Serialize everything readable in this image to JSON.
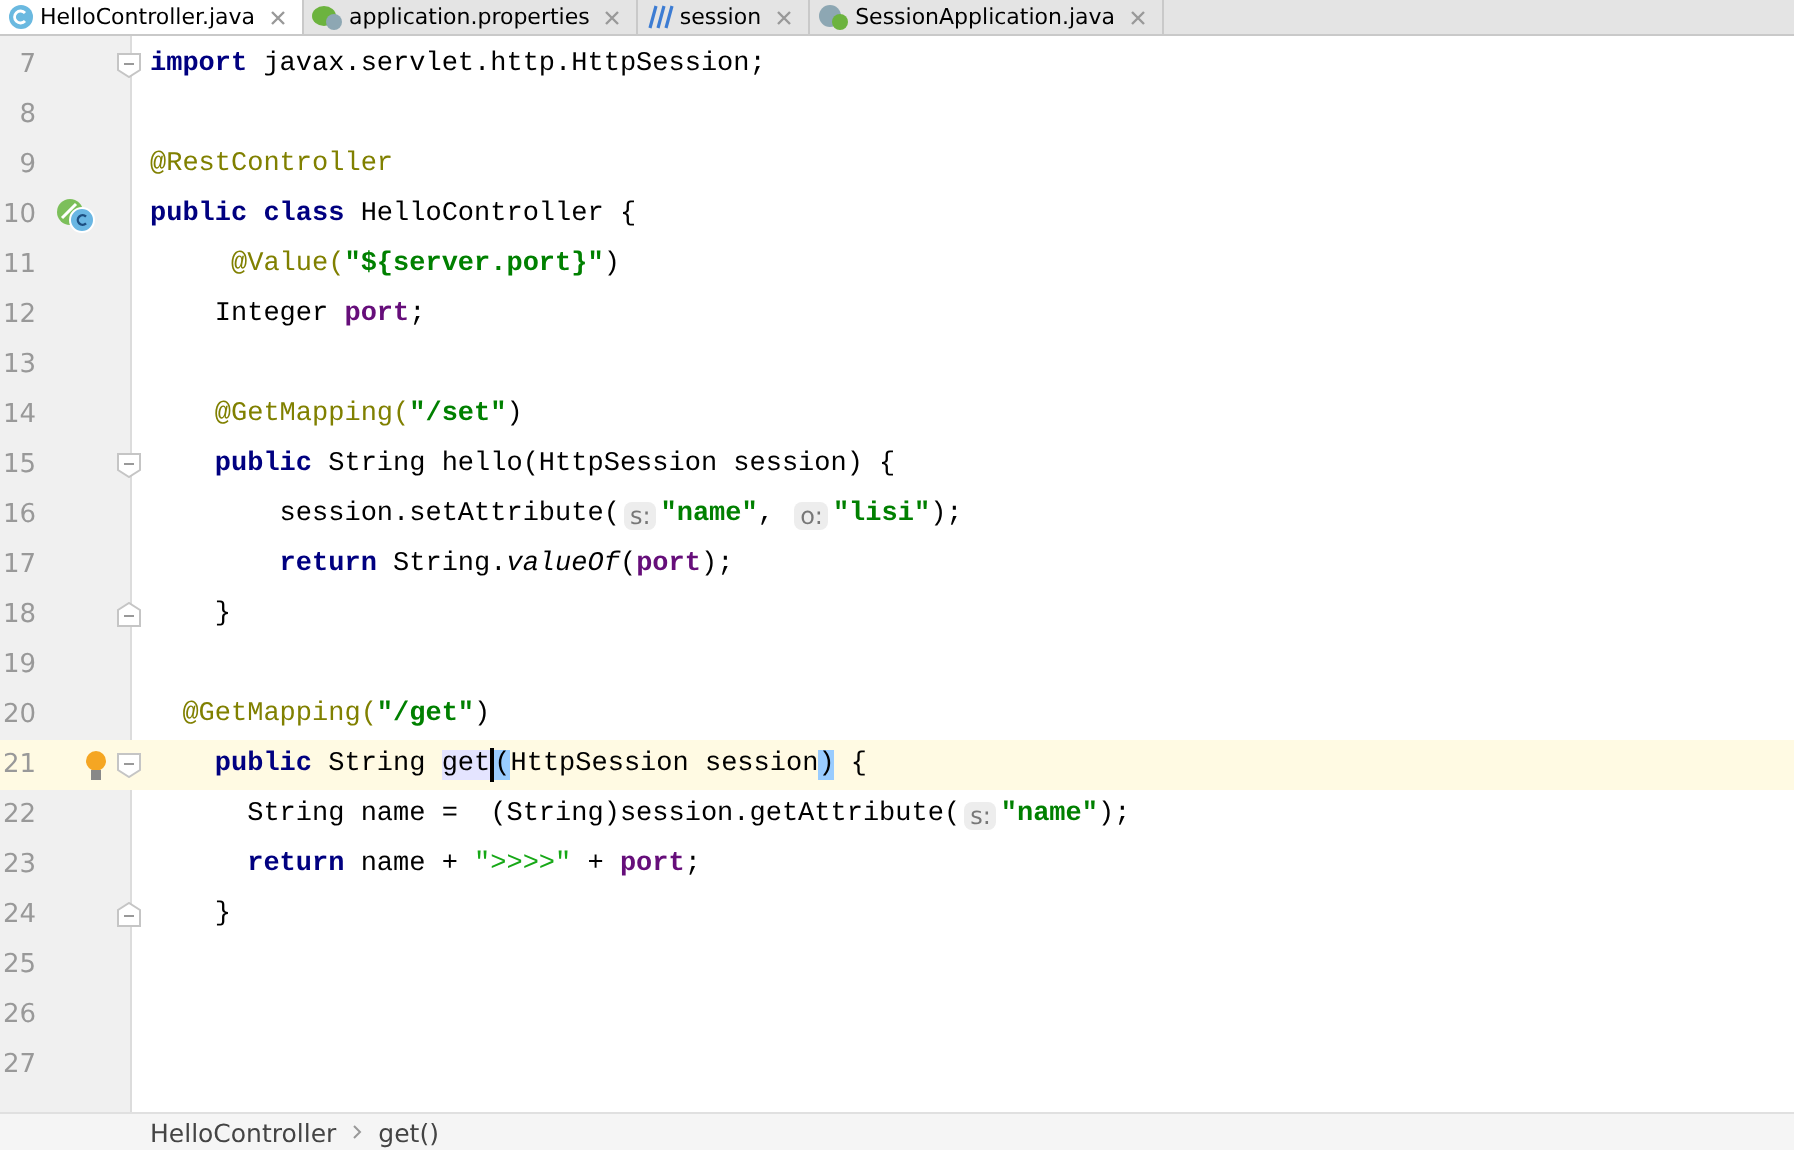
{
  "tabs": [
    {
      "label": "HelloController.java",
      "selected": true,
      "kind": "class"
    },
    {
      "label": "application.properties",
      "selected": false,
      "kind": "properties"
    },
    {
      "label": "session",
      "selected": false,
      "kind": "maven"
    },
    {
      "label": "SessionApplication.java",
      "selected": false,
      "kind": "spring"
    }
  ],
  "lines": [
    {
      "number": "7",
      "current": false,
      "gutter": [
        {
          "kind": "fold-start"
        }
      ],
      "tokens": [
        {
          "kind": "keyword",
          "text": "import"
        },
        {
          "kind": "plain",
          "text": " javax.servlet.http.HttpSession;"
        }
      ]
    },
    {
      "number": "8",
      "current": false
    },
    {
      "number": "9",
      "current": false,
      "tokens": [
        {
          "kind": "annotation",
          "text": "@RestController"
        }
      ]
    },
    {
      "number": "10",
      "current": false,
      "gutter": [
        {
          "kind": "bean"
        }
      ],
      "tokens": [
        {
          "kind": "keyword",
          "text": "public class"
        },
        {
          "kind": "plain",
          "text": " HelloController {"
        }
      ]
    },
    {
      "number": "11",
      "current": false,
      "tokens": [
        {
          "kind": "annotation",
          "text": "     @Value("
        },
        {
          "kind": "string",
          "text": "\"${server.port}\""
        },
        {
          "kind": "plain",
          "text": ")"
        }
      ]
    },
    {
      "number": "12",
      "current": false,
      "tokens": [
        {
          "kind": "plain",
          "text": "    Integer "
        },
        {
          "kind": "field",
          "text": "port"
        },
        {
          "kind": "plain",
          "text": ";"
        }
      ]
    },
    {
      "number": "13",
      "current": false
    },
    {
      "number": "14",
      "current": false,
      "tokens": [
        {
          "kind": "annotation",
          "text": "    @GetMapping("
        },
        {
          "kind": "string",
          "text": "\"/set\""
        },
        {
          "kind": "plain",
          "text": ")"
        }
      ]
    },
    {
      "number": "15",
      "current": false,
      "gutter": [
        {
          "kind": "fold-start"
        }
      ],
      "tokens": [
        {
          "kind": "keyword",
          "text": "    public"
        },
        {
          "kind": "plain",
          "text": " String hello(HttpSession session) {"
        }
      ]
    },
    {
      "number": "16",
      "current": false,
      "tokens": [
        {
          "kind": "plain",
          "text": "        session.setAttribute("
        },
        {
          "kind": "hint",
          "text": "s:"
        },
        {
          "kind": "string",
          "text": "\"name\""
        },
        {
          "kind": "plain",
          "text": ", "
        },
        {
          "kind": "hint",
          "text": "o:"
        },
        {
          "kind": "string",
          "text": "\"lisi\""
        },
        {
          "kind": "plain",
          "text": ");"
        }
      ]
    },
    {
      "number": "17",
      "current": false,
      "tokens": [
        {
          "kind": "keyword",
          "text": "        return"
        },
        {
          "kind": "plain",
          "text": " String."
        },
        {
          "kind": "italic",
          "text": "valueOf"
        },
        {
          "kind": "plain",
          "text": "("
        },
        {
          "kind": "field",
          "text": "port"
        },
        {
          "kind": "plain",
          "text": ");"
        }
      ]
    },
    {
      "number": "18",
      "current": false,
      "gutter": [
        {
          "kind": "fold-end"
        }
      ],
      "tokens": [
        {
          "kind": "plain",
          "text": "    }"
        }
      ]
    },
    {
      "number": "19",
      "current": false
    },
    {
      "number": "20",
      "current": false,
      "tokens": [
        {
          "kind": "annotation",
          "text": "  @GetMapping("
        },
        {
          "kind": "string",
          "text": "\"/get\""
        },
        {
          "kind": "plain",
          "text": ")"
        }
      ]
    },
    {
      "number": "21",
      "current": true,
      "gutter": [
        {
          "kind": "bulb"
        },
        {
          "kind": "fold-start"
        }
      ],
      "tokens": [
        {
          "kind": "keyword",
          "text": "    public"
        },
        {
          "kind": "plain",
          "text": " String "
        },
        {
          "kind": "usage",
          "text": "get",
          "caret_after": true
        },
        {
          "kind": "brace",
          "text": "("
        },
        {
          "kind": "plain",
          "text": "HttpSession session"
        },
        {
          "kind": "brace",
          "text": ")"
        },
        {
          "kind": "plain",
          "text": " {"
        }
      ]
    },
    {
      "number": "22",
      "current": false,
      "tokens": [
        {
          "kind": "plain",
          "text": "      String name =  (String)session.getAttribute("
        },
        {
          "kind": "hint",
          "text": "s:"
        },
        {
          "kind": "string",
          "text": "\"name\""
        },
        {
          "kind": "plain",
          "text": ");"
        }
      ]
    },
    {
      "number": "23",
      "current": false,
      "tokens": [
        {
          "kind": "keyword",
          "text": "      return"
        },
        {
          "kind": "plain",
          "text": " name + "
        },
        {
          "kind": "string-light",
          "text": "\">>>>\""
        },
        {
          "kind": "plain",
          "text": " + "
        },
        {
          "kind": "field",
          "text": "port"
        },
        {
          "kind": "plain",
          "text": ";"
        }
      ]
    },
    {
      "number": "24",
      "current": false,
      "gutter": [
        {
          "kind": "fold-end"
        }
      ],
      "tokens": [
        {
          "kind": "plain",
          "text": "    }"
        }
      ]
    },
    {
      "number": "25",
      "current": false
    },
    {
      "number": "26",
      "current": false
    },
    {
      "number": "27",
      "current": false
    }
  ],
  "breadcrumbs": [
    "HelloController",
    "get()"
  ]
}
